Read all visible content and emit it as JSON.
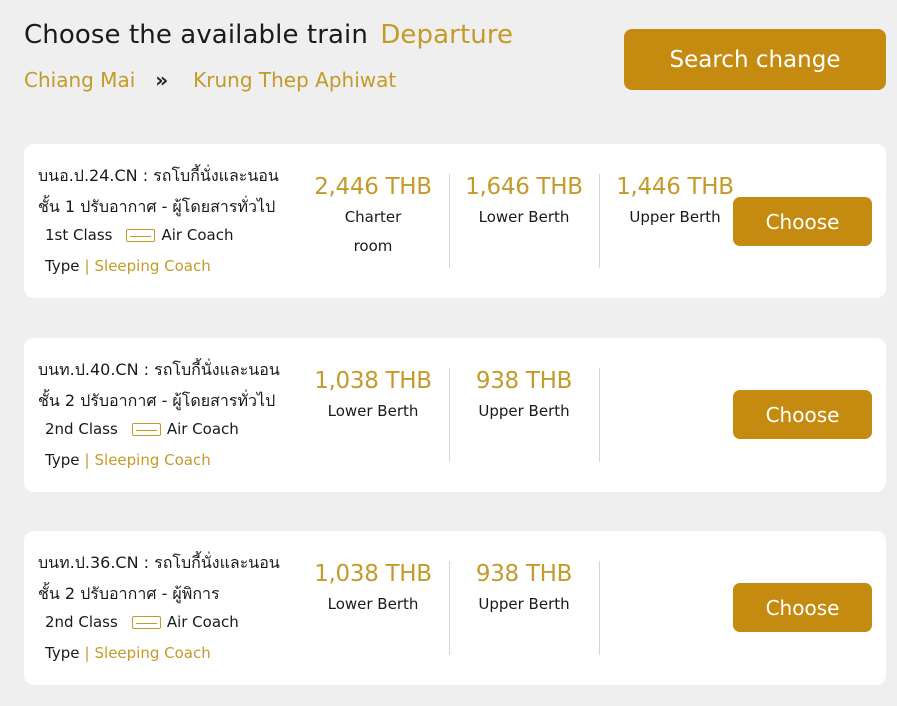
{
  "header": {
    "title": "Choose the available train",
    "title_highlight": "Departure",
    "origin": "Chiang Mai",
    "route_separator": "»",
    "destination": "Krung Thep Aphiwat",
    "search_change_label": "Search change"
  },
  "trains": [
    {
      "name_line1": "บนอ.ป.24.CN : รถโบกี้นั่งและนอน",
      "name_line2": "ชั้น 1 ปรับอากาศ - ผู้โดยสารทั่วไป",
      "class": "1st Class",
      "coach": "Air Coach",
      "type_label": "Type",
      "type_value": "Sleeping Coach",
      "prices": [
        {
          "price": "2,446 THB",
          "label_line1": "Charter",
          "label_line2": "room"
        },
        {
          "price": "1,646 THB",
          "label_line1": "Lower Berth",
          "label_line2": ""
        },
        {
          "price": "1,446 THB",
          "label_line1": "Upper Berth",
          "label_line2": ""
        }
      ],
      "choose_label": "Choose"
    },
    {
      "name_line1": "บนท.ป.40.CN : รถโบกี้นั่งและนอน",
      "name_line2": "ชั้น 2 ปรับอากาศ - ผู้โดยสารทั่วไป",
      "class": "2nd Class",
      "coach": "Air Coach",
      "type_label": "Type",
      "type_value": "Sleeping Coach",
      "prices": [
        {
          "price": "1,038 THB",
          "label_line1": "Lower Berth",
          "label_line2": ""
        },
        {
          "price": "938 THB",
          "label_line1": "Upper Berth",
          "label_line2": ""
        }
      ],
      "choose_label": "Choose"
    },
    {
      "name_line1": "บนท.ป.36.CN : รถโบกี้นั่งและนอน",
      "name_line2": "ชั้น 2 ปรับอากาศ - ผู้พิการ",
      "class": "2nd Class",
      "coach": "Air Coach",
      "type_label": "Type",
      "type_value": "Sleeping Coach",
      "prices": [
        {
          "price": "1,038 THB",
          "label_line1": "Lower Berth",
          "label_line2": ""
        },
        {
          "price": "938 THB",
          "label_line1": "Upper Berth",
          "label_line2": ""
        }
      ],
      "choose_label": "Choose"
    }
  ]
}
